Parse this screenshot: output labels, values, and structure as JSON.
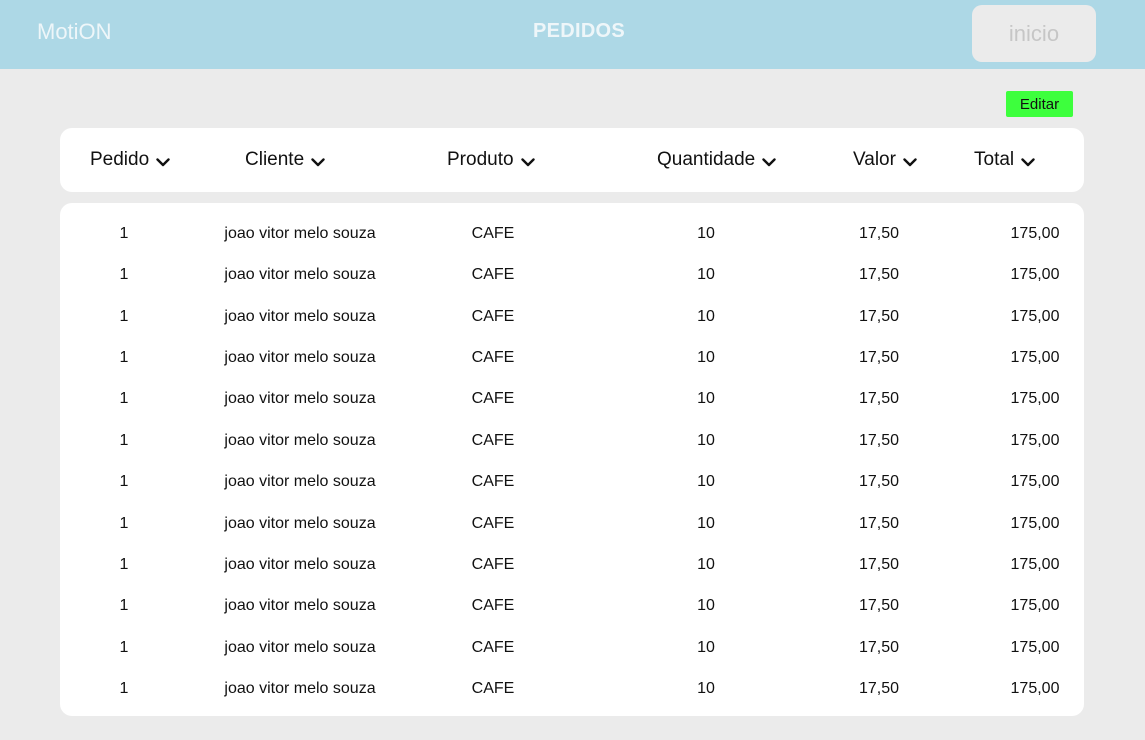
{
  "app": {
    "brand": "MotiON",
    "page_title": "PEDIDOS",
    "inicio_label": "inicio"
  },
  "toolbar": {
    "edit_label": "Editar"
  },
  "table": {
    "headers": [
      "Pedido",
      "Cliente",
      "Produto",
      "Quantidade",
      "Valor",
      "Total"
    ],
    "rows": [
      [
        "1",
        "joao vitor melo souza",
        "CAFE",
        "10",
        "17,50",
        "175,00"
      ],
      [
        "1",
        "joao vitor melo souza",
        "CAFE",
        "10",
        "17,50",
        "175,00"
      ],
      [
        "1",
        "joao vitor melo souza",
        "CAFE",
        "10",
        "17,50",
        "175,00"
      ],
      [
        "1",
        "joao vitor melo souza",
        "CAFE",
        "10",
        "17,50",
        "175,00"
      ],
      [
        "1",
        "joao vitor melo souza",
        "CAFE",
        "10",
        "17,50",
        "175,00"
      ],
      [
        "1",
        "joao vitor melo souza",
        "CAFE",
        "10",
        "17,50",
        "175,00"
      ],
      [
        "1",
        "joao vitor melo souza",
        "CAFE",
        "10",
        "17,50",
        "175,00"
      ],
      [
        "1",
        "joao vitor melo souza",
        "CAFE",
        "10",
        "17,50",
        "175,00"
      ],
      [
        "1",
        "joao vitor melo souza",
        "CAFE",
        "10",
        "17,50",
        "175,00"
      ],
      [
        "1",
        "joao vitor melo souza",
        "CAFE",
        "10",
        "17,50",
        "175,00"
      ],
      [
        "1",
        "joao vitor melo souza",
        "CAFE",
        "10",
        "17,50",
        "175,00"
      ],
      [
        "1",
        "joao vitor melo souza",
        "CAFE",
        "10",
        "17,50",
        "175,00"
      ]
    ]
  },
  "icons": {
    "sort": "chevron-down-icon"
  },
  "colors": {
    "topbar": "#add8e6",
    "background": "#ebebeb",
    "edit_button": "#3dff3d",
    "card": "#ffffff"
  }
}
